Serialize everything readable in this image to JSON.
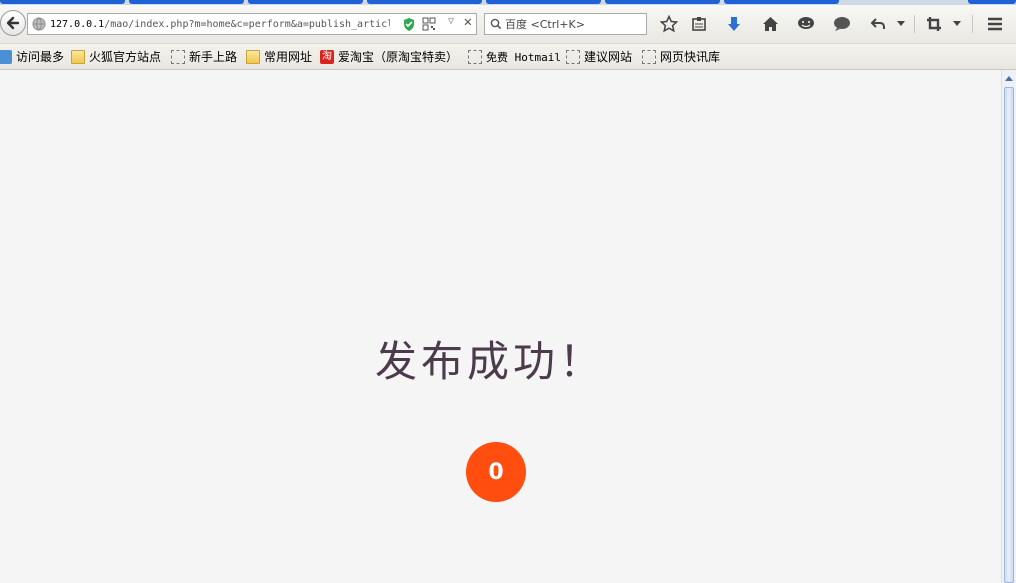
{
  "browser": {
    "address": {
      "host": "127.0.0.1",
      "path": "/mao/index.php?m=home&c=perform&a=publish_articl"
    },
    "search_placeholder": "百度 <Ctrl+K>",
    "icons": [
      "back-icon",
      "globe-icon",
      "shield-icon",
      "qr-icon",
      "dropdown-icon",
      "close-icon",
      "search-icon",
      "star-icon",
      "reading-list-icon",
      "download-icon",
      "home-icon",
      "chat-icon",
      "speech-icon",
      "undo-icon",
      "crop-icon",
      "menu-icon"
    ]
  },
  "bookmarks": [
    {
      "label": "访问最多",
      "icon": "web-icon"
    },
    {
      "label": "火狐官方站点",
      "icon": "folder-icon"
    },
    {
      "label": "新手上路",
      "icon": "bookmark-icon"
    },
    {
      "label": "常用网址",
      "icon": "folder-icon"
    },
    {
      "label": "爱淘宝（原淘宝特卖）",
      "icon": "taobao-icon",
      "icon_text": "淘"
    },
    {
      "label": "免费 Hotmail",
      "icon": "bookmark-icon"
    },
    {
      "label": "建议网站",
      "icon": "bookmark-icon"
    },
    {
      "label": "网页快讯库",
      "icon": "bookmark-icon"
    }
  ],
  "page": {
    "message": "发布成功！",
    "countdown": "0"
  },
  "colors": {
    "accent": "#ff4e0f",
    "message_text": "#4b3b4d",
    "background": "#f5f5f5"
  }
}
